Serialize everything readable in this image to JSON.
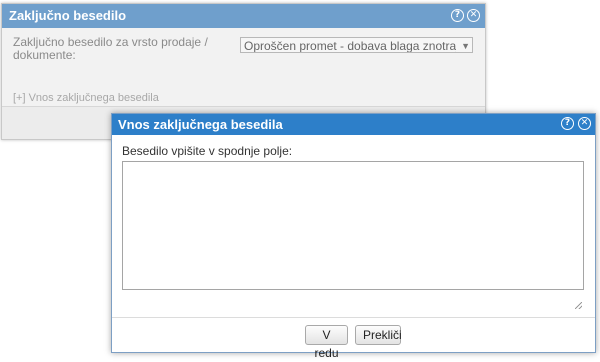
{
  "background_dialog": {
    "title": "Zaključno besedilo",
    "field_label": "Zaključno besedilo za vrsto prodaje / dokumente:",
    "selected_value": "Oproščen promet - dobava blaga znotraj EU",
    "add_link": "[+] Vnos zaključnega besedila",
    "help_icon": "help-icon",
    "close_icon": "close-icon"
  },
  "dialog": {
    "title": "Vnos zaključnega besedila",
    "instruction": "Besedilo vpišite v spodnje polje:",
    "textarea_value": "",
    "ok_label": "V redu",
    "cancel_label": "Prekliči",
    "help_icon": "help-icon",
    "close_icon": "close-icon"
  },
  "colors": {
    "active_titlebar": "#2d7fc9",
    "inactive_titlebar": "#6f9fcc"
  }
}
